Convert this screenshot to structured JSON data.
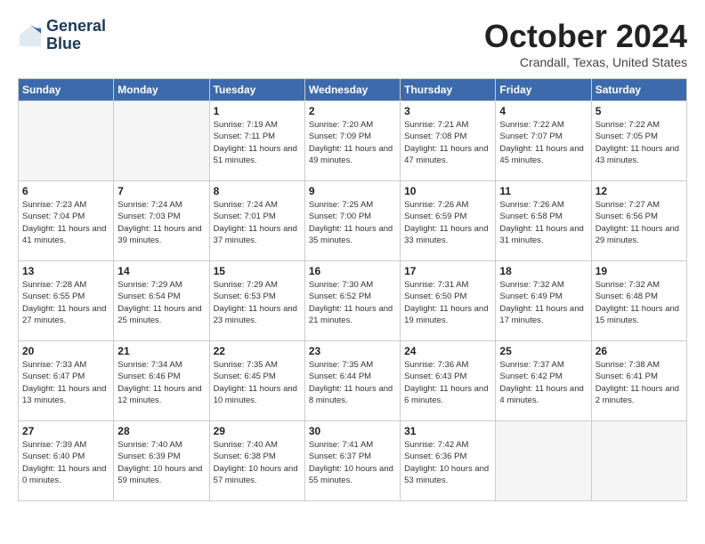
{
  "header": {
    "logo_line1": "General",
    "logo_line2": "Blue",
    "month": "October 2024",
    "location": "Crandall, Texas, United States"
  },
  "days_of_week": [
    "Sunday",
    "Monday",
    "Tuesday",
    "Wednesday",
    "Thursday",
    "Friday",
    "Saturday"
  ],
  "weeks": [
    [
      {
        "num": "",
        "info": ""
      },
      {
        "num": "",
        "info": ""
      },
      {
        "num": "1",
        "info": "Sunrise: 7:19 AM\nSunset: 7:11 PM\nDaylight: 11 hours and 51 minutes."
      },
      {
        "num": "2",
        "info": "Sunrise: 7:20 AM\nSunset: 7:09 PM\nDaylight: 11 hours and 49 minutes."
      },
      {
        "num": "3",
        "info": "Sunrise: 7:21 AM\nSunset: 7:08 PM\nDaylight: 11 hours and 47 minutes."
      },
      {
        "num": "4",
        "info": "Sunrise: 7:22 AM\nSunset: 7:07 PM\nDaylight: 11 hours and 45 minutes."
      },
      {
        "num": "5",
        "info": "Sunrise: 7:22 AM\nSunset: 7:05 PM\nDaylight: 11 hours and 43 minutes."
      }
    ],
    [
      {
        "num": "6",
        "info": "Sunrise: 7:23 AM\nSunset: 7:04 PM\nDaylight: 11 hours and 41 minutes."
      },
      {
        "num": "7",
        "info": "Sunrise: 7:24 AM\nSunset: 7:03 PM\nDaylight: 11 hours and 39 minutes."
      },
      {
        "num": "8",
        "info": "Sunrise: 7:24 AM\nSunset: 7:01 PM\nDaylight: 11 hours and 37 minutes."
      },
      {
        "num": "9",
        "info": "Sunrise: 7:25 AM\nSunset: 7:00 PM\nDaylight: 11 hours and 35 minutes."
      },
      {
        "num": "10",
        "info": "Sunrise: 7:26 AM\nSunset: 6:59 PM\nDaylight: 11 hours and 33 minutes."
      },
      {
        "num": "11",
        "info": "Sunrise: 7:26 AM\nSunset: 6:58 PM\nDaylight: 11 hours and 31 minutes."
      },
      {
        "num": "12",
        "info": "Sunrise: 7:27 AM\nSunset: 6:56 PM\nDaylight: 11 hours and 29 minutes."
      }
    ],
    [
      {
        "num": "13",
        "info": "Sunrise: 7:28 AM\nSunset: 6:55 PM\nDaylight: 11 hours and 27 minutes."
      },
      {
        "num": "14",
        "info": "Sunrise: 7:29 AM\nSunset: 6:54 PM\nDaylight: 11 hours and 25 minutes."
      },
      {
        "num": "15",
        "info": "Sunrise: 7:29 AM\nSunset: 6:53 PM\nDaylight: 11 hours and 23 minutes."
      },
      {
        "num": "16",
        "info": "Sunrise: 7:30 AM\nSunset: 6:52 PM\nDaylight: 11 hours and 21 minutes."
      },
      {
        "num": "17",
        "info": "Sunrise: 7:31 AM\nSunset: 6:50 PM\nDaylight: 11 hours and 19 minutes."
      },
      {
        "num": "18",
        "info": "Sunrise: 7:32 AM\nSunset: 6:49 PM\nDaylight: 11 hours and 17 minutes."
      },
      {
        "num": "19",
        "info": "Sunrise: 7:32 AM\nSunset: 6:48 PM\nDaylight: 11 hours and 15 minutes."
      }
    ],
    [
      {
        "num": "20",
        "info": "Sunrise: 7:33 AM\nSunset: 6:47 PM\nDaylight: 11 hours and 13 minutes."
      },
      {
        "num": "21",
        "info": "Sunrise: 7:34 AM\nSunset: 6:46 PM\nDaylight: 11 hours and 12 minutes."
      },
      {
        "num": "22",
        "info": "Sunrise: 7:35 AM\nSunset: 6:45 PM\nDaylight: 11 hours and 10 minutes."
      },
      {
        "num": "23",
        "info": "Sunrise: 7:35 AM\nSunset: 6:44 PM\nDaylight: 11 hours and 8 minutes."
      },
      {
        "num": "24",
        "info": "Sunrise: 7:36 AM\nSunset: 6:43 PM\nDaylight: 11 hours and 6 minutes."
      },
      {
        "num": "25",
        "info": "Sunrise: 7:37 AM\nSunset: 6:42 PM\nDaylight: 11 hours and 4 minutes."
      },
      {
        "num": "26",
        "info": "Sunrise: 7:38 AM\nSunset: 6:41 PM\nDaylight: 11 hours and 2 minutes."
      }
    ],
    [
      {
        "num": "27",
        "info": "Sunrise: 7:39 AM\nSunset: 6:40 PM\nDaylight: 11 hours and 0 minutes."
      },
      {
        "num": "28",
        "info": "Sunrise: 7:40 AM\nSunset: 6:39 PM\nDaylight: 10 hours and 59 minutes."
      },
      {
        "num": "29",
        "info": "Sunrise: 7:40 AM\nSunset: 6:38 PM\nDaylight: 10 hours and 57 minutes."
      },
      {
        "num": "30",
        "info": "Sunrise: 7:41 AM\nSunset: 6:37 PM\nDaylight: 10 hours and 55 minutes."
      },
      {
        "num": "31",
        "info": "Sunrise: 7:42 AM\nSunset: 6:36 PM\nDaylight: 10 hours and 53 minutes."
      },
      {
        "num": "",
        "info": ""
      },
      {
        "num": "",
        "info": ""
      }
    ]
  ]
}
